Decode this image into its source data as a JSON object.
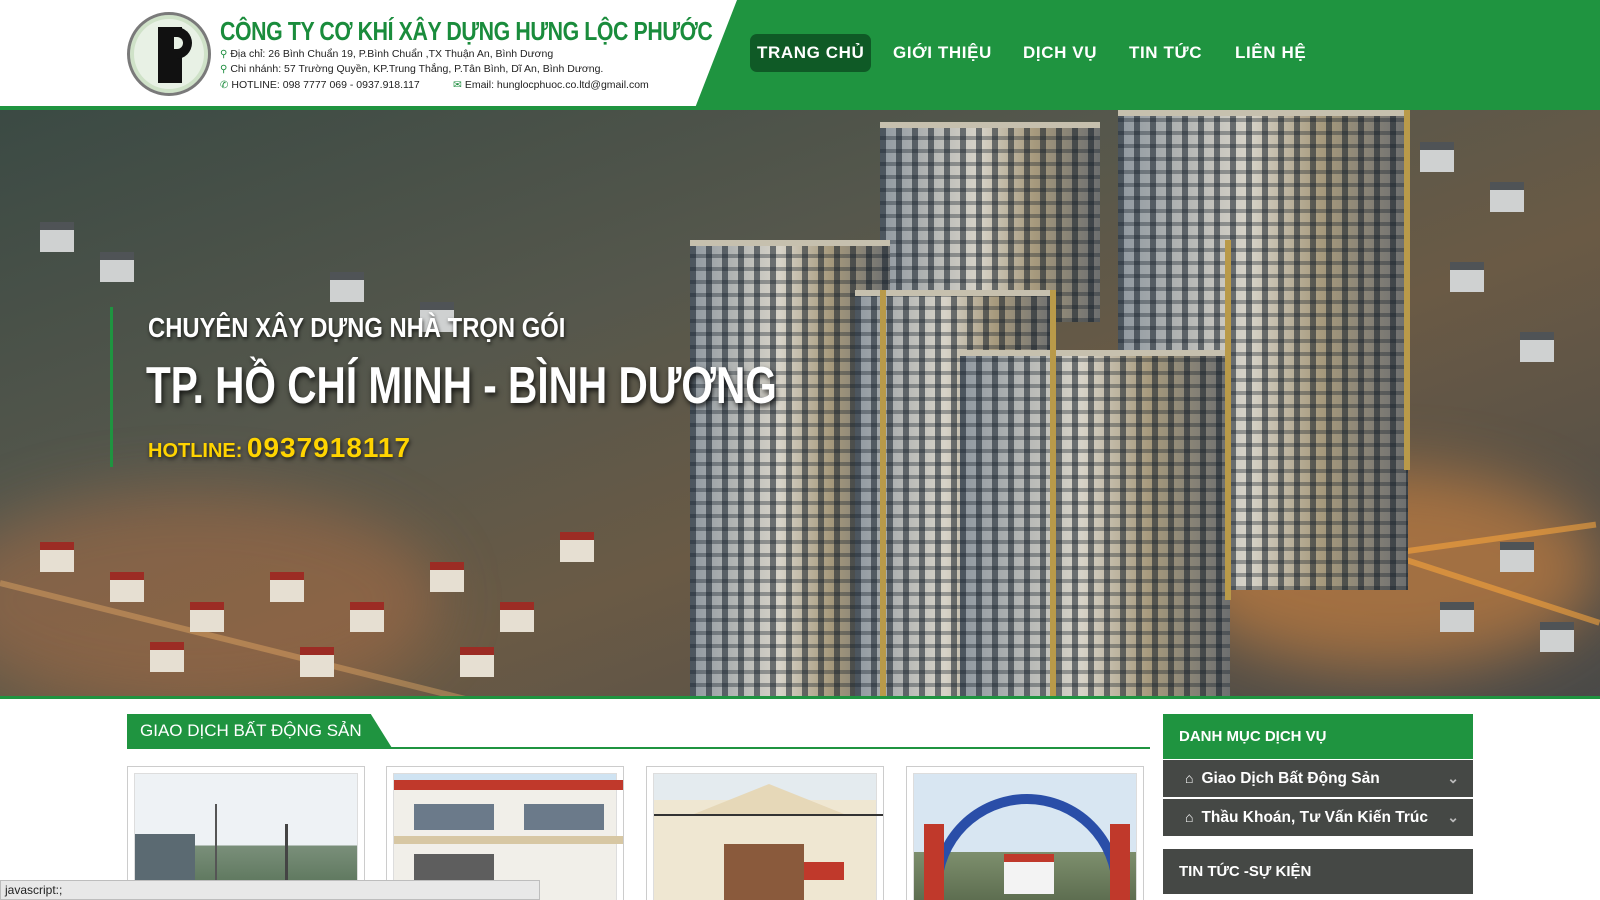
{
  "header": {
    "company_name": "CÔNG TY CƠ KHÍ XÂY DỰNG HƯNG LỘC PHƯỚC",
    "address": "Địa chỉ:  26 Bình Chuẩn 19, P.Bình Chuẩn ,TX Thuận An, Bình Dương",
    "branch": "Chi nhánh:  57 Trường Quyền, KP.Trung Thắng, P.Tân Bình, Dĩ An, Bình Dương.",
    "hotline": "HOTLINE: 098 7777 069 - 0937.918.117",
    "email": "Email: hunglocphuoc.co.ltd@gmail.com"
  },
  "nav": {
    "items": [
      {
        "label": "TRANG CHỦ",
        "active": true
      },
      {
        "label": "GIỚI THIỆU",
        "active": false
      },
      {
        "label": "DỊCH VỤ",
        "active": false
      },
      {
        "label": "TIN TỨC",
        "active": false
      },
      {
        "label": "LIÊN HỆ",
        "active": false
      }
    ]
  },
  "hero": {
    "line1": "CHUYÊN XÂY DỰNG NHÀ TRỌN GÓI",
    "line2": "TP. HỒ CHÍ MINH - BÌNH DƯƠNG",
    "hotline_label": "HOTLINE:",
    "hotline_number": "0937918117"
  },
  "main": {
    "section_title": "GIAO DỊCH BẤT ĐỘNG SẢN"
  },
  "sidebar": {
    "category_title": "DANH MỤC DỊCH VỤ",
    "items": [
      {
        "label": "Giao Dịch Bất Động Sản"
      },
      {
        "label": "Thầu Khoán, Tư Vấn Kiến Trúc"
      }
    ],
    "news_title": "TIN TỨC -SỰ KIỆN"
  },
  "status_bar": "javascript:;",
  "colors": {
    "brand_green": "#1f9440",
    "active_nav": "#0f5a26",
    "sidebar_dark": "#454845",
    "hotline_yellow": "#ffd400"
  }
}
